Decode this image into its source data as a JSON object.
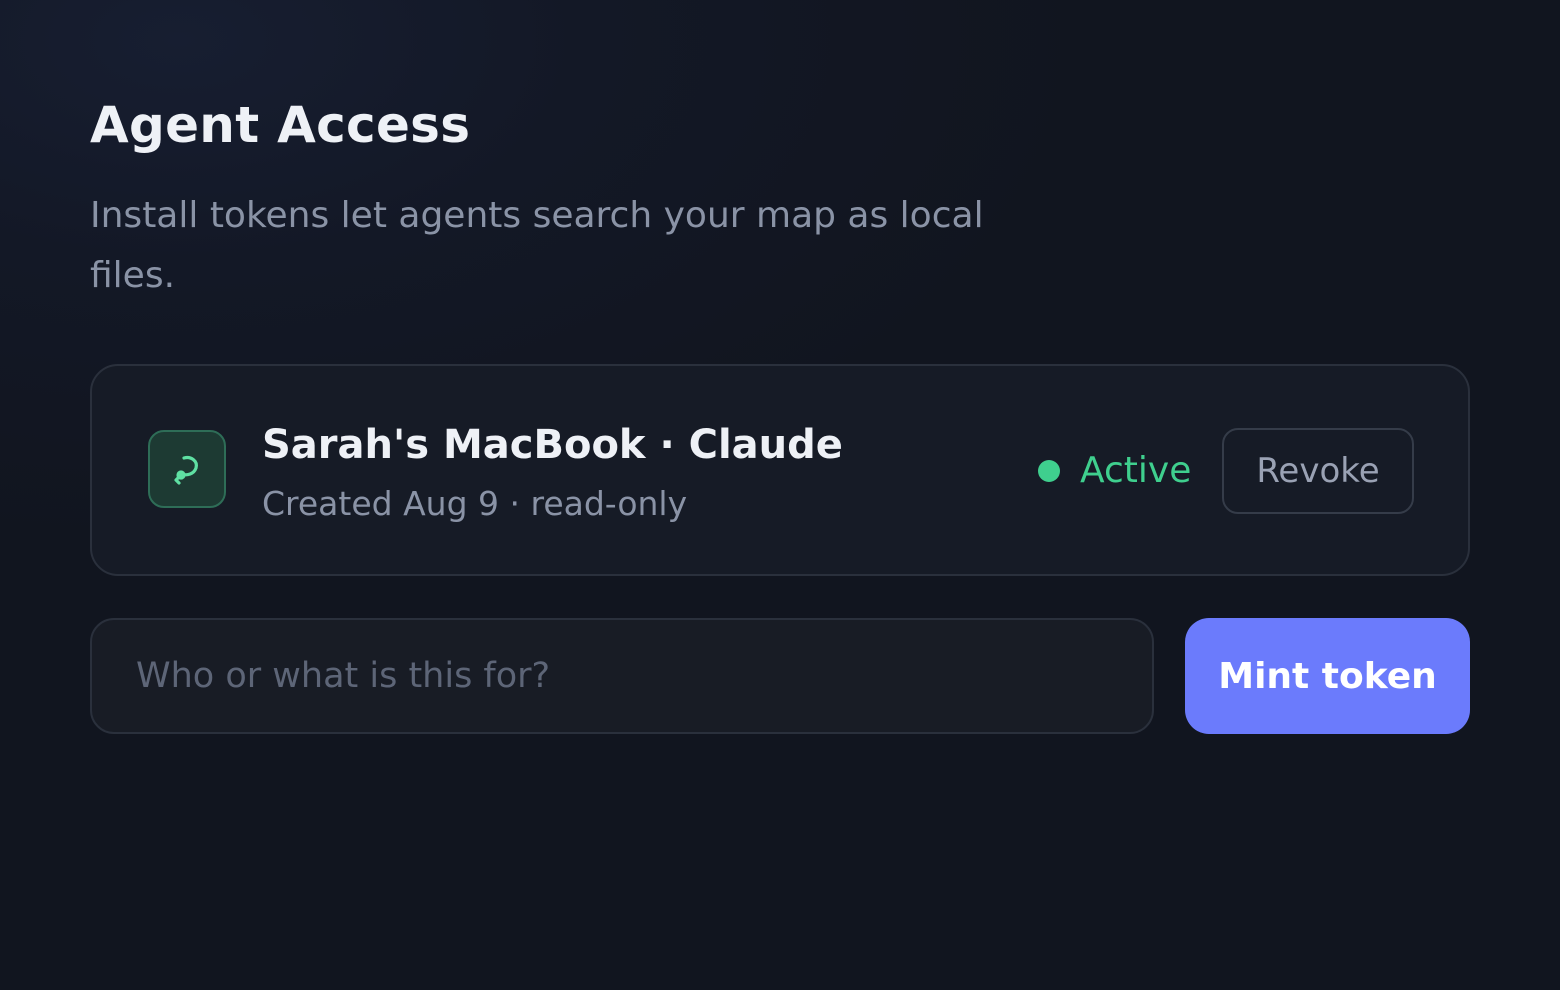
{
  "header": {
    "title": "Agent Access",
    "subtitle": "Install tokens let agents search your map as local files."
  },
  "tokens": [
    {
      "name": "Sarah's MacBook · Claude",
      "meta": "Created Aug 9 · read-only",
      "icon": "key-icon",
      "status": "Active",
      "status_color": "#3fcf8e",
      "revoke_label": "Revoke"
    }
  ],
  "mint": {
    "placeholder": "Who or what is this for?",
    "value": "",
    "button_label": "Mint token",
    "button_color": "#6b7bfc"
  }
}
